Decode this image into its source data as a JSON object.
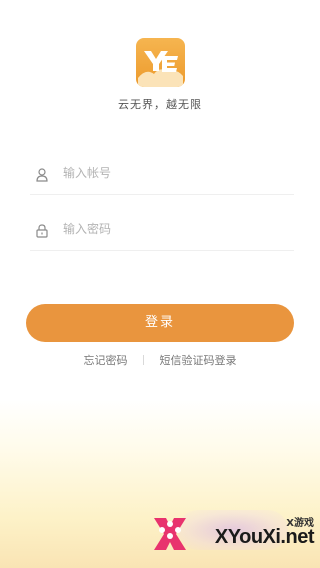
{
  "brand": {
    "tagline": "云无界，越无限",
    "logo_text": "YE",
    "logo_color": "#ec9a2c"
  },
  "form": {
    "account_placeholder": "输入帐号",
    "account_icon": "user-icon",
    "password_placeholder": "输入密码",
    "password_icon": "lock-icon",
    "login_label": "登录",
    "login_color": "#e9953e"
  },
  "links": {
    "forgot_password": "忘记密码",
    "sms_login": "短信验证码登录"
  },
  "watermark": {
    "small_text": "X游戏",
    "big_text": "XYouXi.net"
  }
}
